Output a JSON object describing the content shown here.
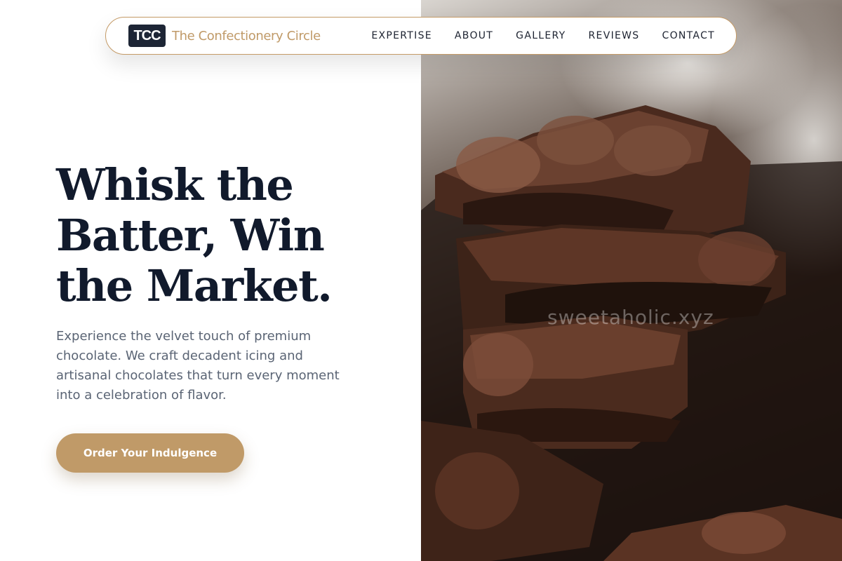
{
  "nav": {
    "logo_mark": "TCC",
    "brand_name": "The Confectionery Circle",
    "links": [
      {
        "label": "EXPERTISE"
      },
      {
        "label": "ABOUT"
      },
      {
        "label": "GALLERY"
      },
      {
        "label": "REVIEWS"
      },
      {
        "label": "CONTACT"
      }
    ]
  },
  "hero": {
    "headline_lines": [
      "Whisk the",
      "Batter, Win",
      "the Market."
    ],
    "subtext": "Experience the velvet touch of premium chocolate. We craft decadent icing and artisanal chocolates that turn every moment into a celebration of flavor.",
    "cta_label": "Order Your Indulgence",
    "image_watermark": "sweetaholic.xyz",
    "image_subject": "stacked-chocolate-bars-photo"
  },
  "colors": {
    "accent_gold": "#c09a68",
    "navy": "#111a2c",
    "body_text": "#5a6474",
    "logo_bg": "#1d2535"
  }
}
